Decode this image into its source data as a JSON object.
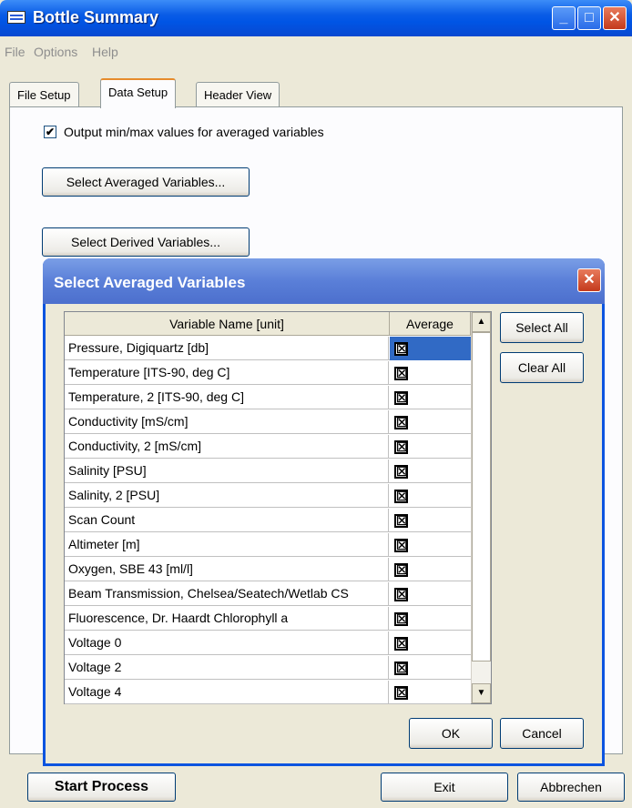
{
  "window": {
    "title": "Bottle Summary",
    "minimize": "_",
    "maximize": "□",
    "close": "✕"
  },
  "menu": [
    "File",
    "Options",
    "Help"
  ],
  "tabs": [
    "File Setup",
    "Data Setup",
    "Header View"
  ],
  "active_tab": "Data Setup",
  "options": {
    "minmax_label": "Output min/max values for averaged variables",
    "minmax_checked": "✔",
    "select_averaged_btn": "Select Averaged Variables...",
    "select_derived_btn": "Select Derived Variables..."
  },
  "dialog": {
    "title": "Select Averaged Variables",
    "close": "✕",
    "col_name": "Variable Name [unit]",
    "col_avg": "Average",
    "select_all": "Select All",
    "clear_all": "Clear All",
    "ok": "OK",
    "cancel": "Cancel",
    "scroll_up": "▲",
    "scroll_down": "▼",
    "rows": [
      {
        "name": "Pressure, Digiquartz [db]",
        "mark": "☒"
      },
      {
        "name": "Temperature [ITS-90, deg C]",
        "mark": "☒"
      },
      {
        "name": "Temperature, 2 [ITS-90, deg C]",
        "mark": "☒"
      },
      {
        "name": "Conductivity [mS/cm]",
        "mark": "☒"
      },
      {
        "name": "Conductivity, 2 [mS/cm]",
        "mark": "☒"
      },
      {
        "name": "Salinity [PSU]",
        "mark": "☒"
      },
      {
        "name": "Salinity, 2 [PSU]",
        "mark": "☒"
      },
      {
        "name": "Scan Count",
        "mark": "☒"
      },
      {
        "name": "Altimeter [m]",
        "mark": "☒"
      },
      {
        "name": "Oxygen, SBE 43 [ml/l]",
        "mark": "☒"
      },
      {
        "name": "Beam Transmission, Chelsea/Seatech/Wetlab CS",
        "mark": "☒"
      },
      {
        "name": "Fluorescence, Dr. Haardt Chlorophyll a",
        "mark": "☒"
      },
      {
        "name": "Voltage 0",
        "mark": "☒"
      },
      {
        "name": "Voltage 2",
        "mark": "☒"
      },
      {
        "name": "Voltage 4",
        "mark": "☒"
      }
    ]
  },
  "footer": {
    "start": "Start Process",
    "exit": "Exit",
    "abort": "Abbrechen"
  }
}
